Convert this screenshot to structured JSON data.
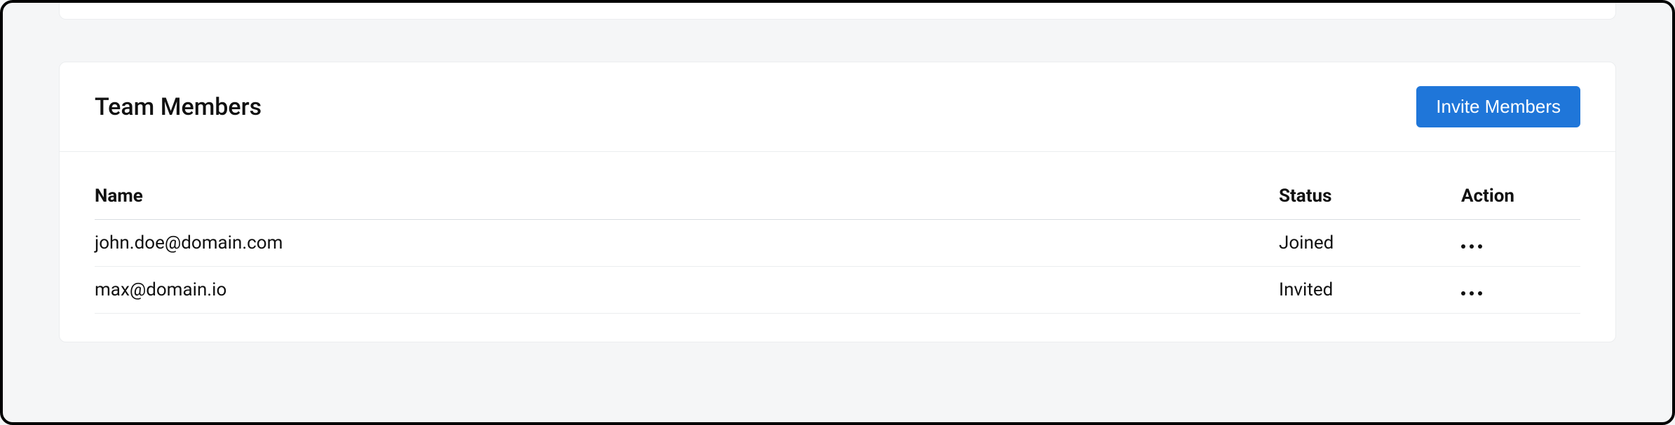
{
  "card": {
    "title": "Team Members",
    "invite_label": "Invite Members"
  },
  "table": {
    "columns": {
      "name": "Name",
      "status": "Status",
      "action": "Action"
    },
    "rows": [
      {
        "name": "john.doe@domain.com",
        "status": "Joined"
      },
      {
        "name": "max@domain.io",
        "status": "Invited"
      }
    ]
  }
}
